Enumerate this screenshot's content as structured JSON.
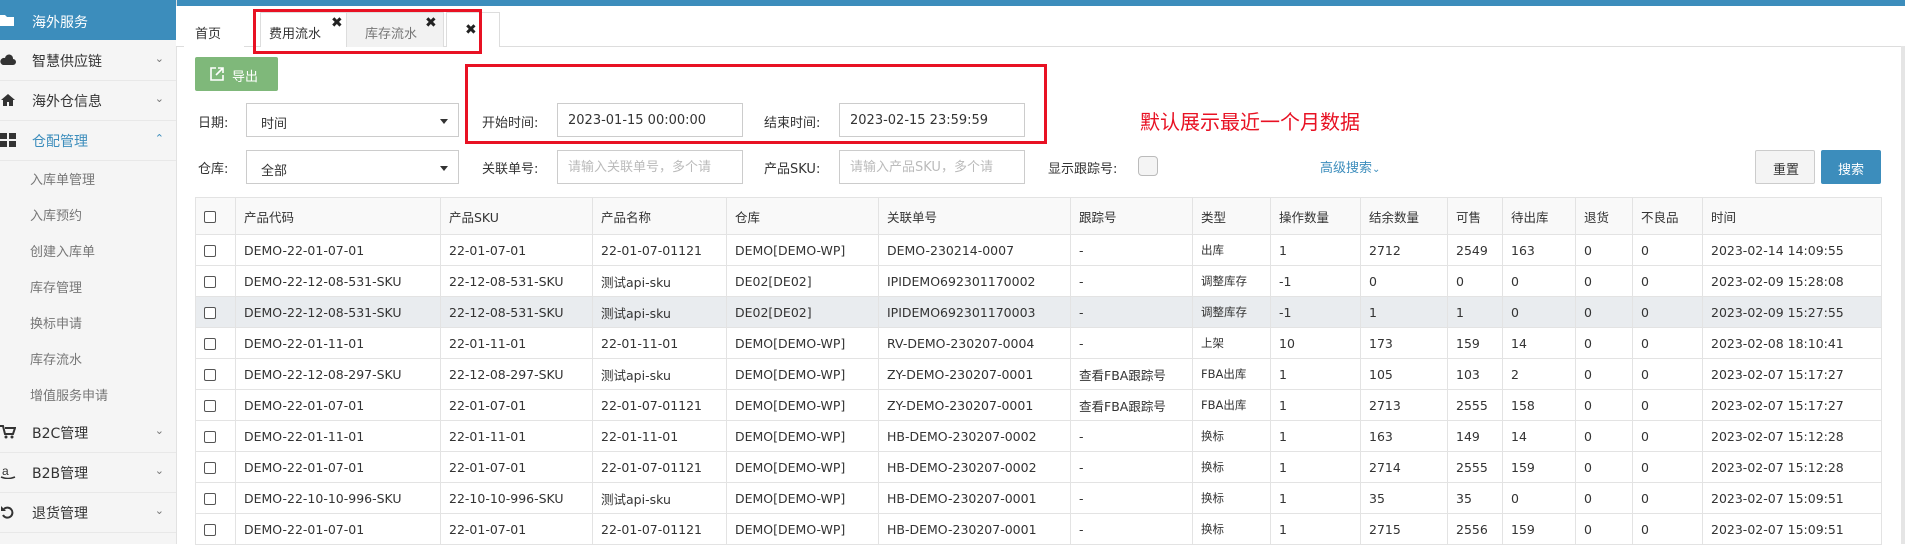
{
  "sidebar": {
    "top_item": "海外服务",
    "items": [
      {
        "label": "智慧供应链",
        "icon": "cloud-icon",
        "expanded": false
      },
      {
        "label": "海外仓信息",
        "icon": "home-icon",
        "expanded": false
      },
      {
        "label": "仓配管理",
        "icon": "grid-icon",
        "expanded": true
      },
      {
        "label": "B2C管理",
        "icon": "cart-icon",
        "expanded": false
      },
      {
        "label": "B2B管理",
        "icon": "amazon-icon",
        "expanded": false
      },
      {
        "label": "退货管理",
        "icon": "return-icon",
        "expanded": false
      }
    ],
    "sub_items": [
      "入库单管理",
      "入库预约",
      "创建入库单",
      "库存管理",
      "换标申请",
      "库存流水",
      "增值服务申请"
    ]
  },
  "tabs": [
    {
      "label": "首页"
    },
    {
      "label": "费用流水"
    },
    {
      "label": "库存流水"
    }
  ],
  "toolbar": {
    "export_label": "导出"
  },
  "filters": {
    "date_label": "日期:",
    "date_type": "时间",
    "start_label": "开始时间:",
    "start_value": "2023-01-15 00:00:00",
    "end_label": "结束时间:",
    "end_value": "2023-02-15 23:59:59",
    "warehouse_label": "仓库:",
    "warehouse_value": "全部",
    "ref_label": "关联单号:",
    "ref_placeholder": "请输入关联单号，多个请",
    "sku_label": "产品SKU:",
    "sku_placeholder": "请输入产品SKU，多个请",
    "show_track_label": "显示跟踪号:",
    "advanced_label": "高级搜索",
    "reset_label": "重置",
    "search_label": "搜索"
  },
  "notice": "默认展示最近一个月数据",
  "colors": {
    "accent": "#3c8dbc",
    "export_green": "#7fb87a",
    "annotation_red": "#e81123"
  },
  "table": {
    "headers": [
      "产品代码",
      "产品SKU",
      "产品名称",
      "仓库",
      "关联单号",
      "跟踪号",
      "类型",
      "操作数量",
      "结余数量",
      "可售",
      "待出库",
      "退货",
      "不良品",
      "时间"
    ],
    "rows": [
      [
        "DEMO-22-01-07-01",
        "22-01-07-01",
        "22-01-07-01121",
        "DEMO[DEMO-WP]",
        "DEMO-230214-0007",
        "-",
        "出库",
        "1",
        "2712",
        "2549",
        "163",
        "0",
        "0",
        "2023-02-14 14:09:55"
      ],
      [
        "DEMO-22-12-08-531-SKU",
        "22-12-08-531-SKU",
        "测试api-sku",
        "DE02[DE02]",
        "IPIDEMO692301170002",
        "-",
        "调整库存",
        "-1",
        "0",
        "0",
        "0",
        "0",
        "0",
        "2023-02-09 15:28:08"
      ],
      [
        "DEMO-22-12-08-531-SKU",
        "22-12-08-531-SKU",
        "测试api-sku",
        "DE02[DE02]",
        "IPIDEMO692301170003",
        "-",
        "调整库存",
        "-1",
        "1",
        "1",
        "0",
        "0",
        "0",
        "2023-02-09 15:27:55"
      ],
      [
        "DEMO-22-01-11-01",
        "22-01-11-01",
        "22-01-11-01",
        "DEMO[DEMO-WP]",
        "RV-DEMO-230207-0004",
        "-",
        "上架",
        "10",
        "173",
        "159",
        "14",
        "0",
        "0",
        "2023-02-08 18:10:41"
      ],
      [
        "DEMO-22-12-08-297-SKU",
        "22-12-08-297-SKU",
        "测试api-sku",
        "DEMO[DEMO-WP]",
        "ZY-DEMO-230207-0001",
        "查看FBA跟踪号",
        "FBA出库",
        "1",
        "105",
        "103",
        "2",
        "0",
        "0",
        "2023-02-07 15:17:27"
      ],
      [
        "DEMO-22-01-07-01",
        "22-01-07-01",
        "22-01-07-01121",
        "DEMO[DEMO-WP]",
        "ZY-DEMO-230207-0001",
        "查看FBA跟踪号",
        "FBA出库",
        "1",
        "2713",
        "2555",
        "158",
        "0",
        "0",
        "2023-02-07 15:17:27"
      ],
      [
        "DEMO-22-01-11-01",
        "22-01-11-01",
        "22-01-11-01",
        "DEMO[DEMO-WP]",
        "HB-DEMO-230207-0002",
        "-",
        "换标",
        "1",
        "163",
        "149",
        "14",
        "0",
        "0",
        "2023-02-07 15:12:28"
      ],
      [
        "DEMO-22-01-07-01",
        "22-01-07-01",
        "22-01-07-01121",
        "DEMO[DEMO-WP]",
        "HB-DEMO-230207-0002",
        "-",
        "换标",
        "1",
        "2714",
        "2555",
        "159",
        "0",
        "0",
        "2023-02-07 15:12:28"
      ],
      [
        "DEMO-22-10-10-996-SKU",
        "22-10-10-996-SKU",
        "测试api-sku",
        "DEMO[DEMO-WP]",
        "HB-DEMO-230207-0001",
        "-",
        "换标",
        "1",
        "35",
        "35",
        "0",
        "0",
        "0",
        "2023-02-07 15:09:51"
      ],
      [
        "DEMO-22-01-07-01",
        "22-01-07-01",
        "22-01-07-01121",
        "DEMO[DEMO-WP]",
        "HB-DEMO-230207-0001",
        "-",
        "换标",
        "1",
        "2715",
        "2556",
        "159",
        "0",
        "0",
        "2023-02-07 15:09:51"
      ]
    ]
  }
}
